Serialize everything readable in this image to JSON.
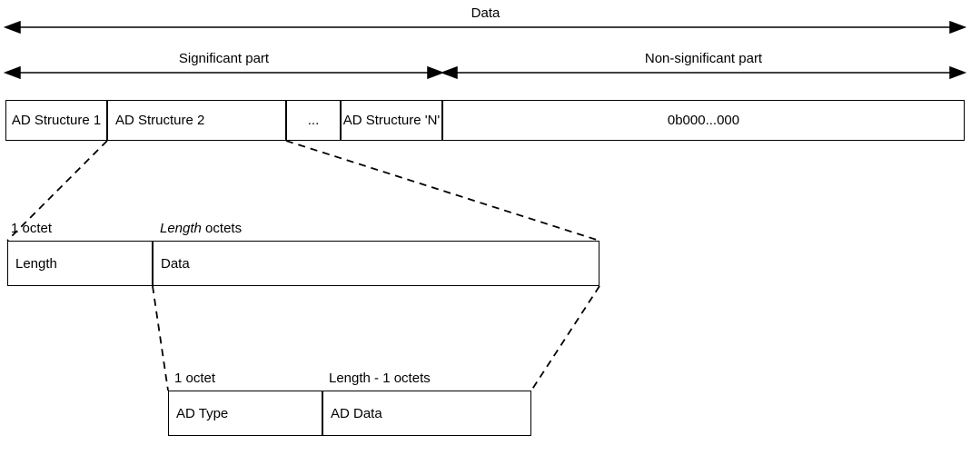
{
  "top_label": "Data",
  "sig_label": "Significant part",
  "nonsig_label": "Non-significant part",
  "row1": {
    "ad1": "AD Structure 1",
    "ad2": "AD Structure 2",
    "dots": "...",
    "adn": "AD Structure 'N'",
    "pad": "0b000...000"
  },
  "row2_labels": {
    "l_octet": "1 octet",
    "l_len_octets_pre": "Length",
    "l_len_octets_post": " octets"
  },
  "row2": {
    "length": "Length",
    "data": "Data"
  },
  "row3_labels": {
    "l_octet": "1 octet",
    "l_rem": "Length - 1 octets"
  },
  "row3": {
    "adtype": "AD Type",
    "addata": "AD Data"
  }
}
